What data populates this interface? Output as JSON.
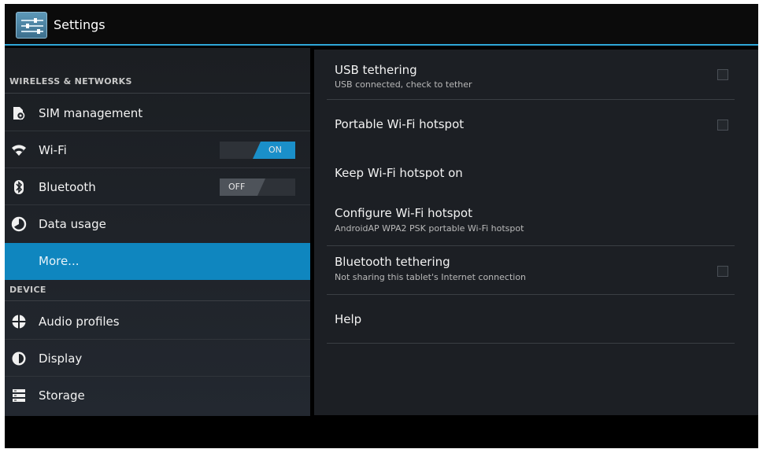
{
  "app": {
    "title": "Settings"
  },
  "sidebar": {
    "sections": [
      {
        "header": "WIRELESS & NETWORKS"
      },
      {
        "header": "DEVICE"
      }
    ],
    "items": [
      {
        "label": "SIM management",
        "icon": "sim-management-icon"
      },
      {
        "label": "Wi-Fi",
        "icon": "wifi-icon",
        "toggle": "ON"
      },
      {
        "label": "Bluetooth",
        "icon": "bluetooth-icon",
        "toggle": "OFF"
      },
      {
        "label": "Data usage",
        "icon": "data-usage-icon"
      },
      {
        "label": "More...",
        "selected": true
      },
      {
        "label": "Audio profiles",
        "icon": "audio-profiles-icon"
      },
      {
        "label": "Display",
        "icon": "display-icon"
      },
      {
        "label": "Storage",
        "icon": "storage-icon"
      }
    ]
  },
  "panel": {
    "items": [
      {
        "title": "USB tethering",
        "summary": "USB connected, check to tether",
        "checkbox": true,
        "checked": false
      },
      {
        "title": "Portable Wi-Fi hotspot",
        "checkbox": true,
        "checked": false
      },
      {
        "title": "Keep Wi-Fi hotspot on"
      },
      {
        "title": "Configure Wi-Fi hotspot",
        "summary": "AndroidAP WPA2 PSK portable Wi-Fi hotspot"
      },
      {
        "title": "Bluetooth tethering",
        "summary": "Not sharing this tablet's Internet connection",
        "checkbox": true,
        "checked": false
      },
      {
        "title": "Help"
      }
    ]
  },
  "colors": {
    "accent": "#0f86bf",
    "actionbar_line": "#2fa7d8",
    "background": "#1c1f24"
  }
}
